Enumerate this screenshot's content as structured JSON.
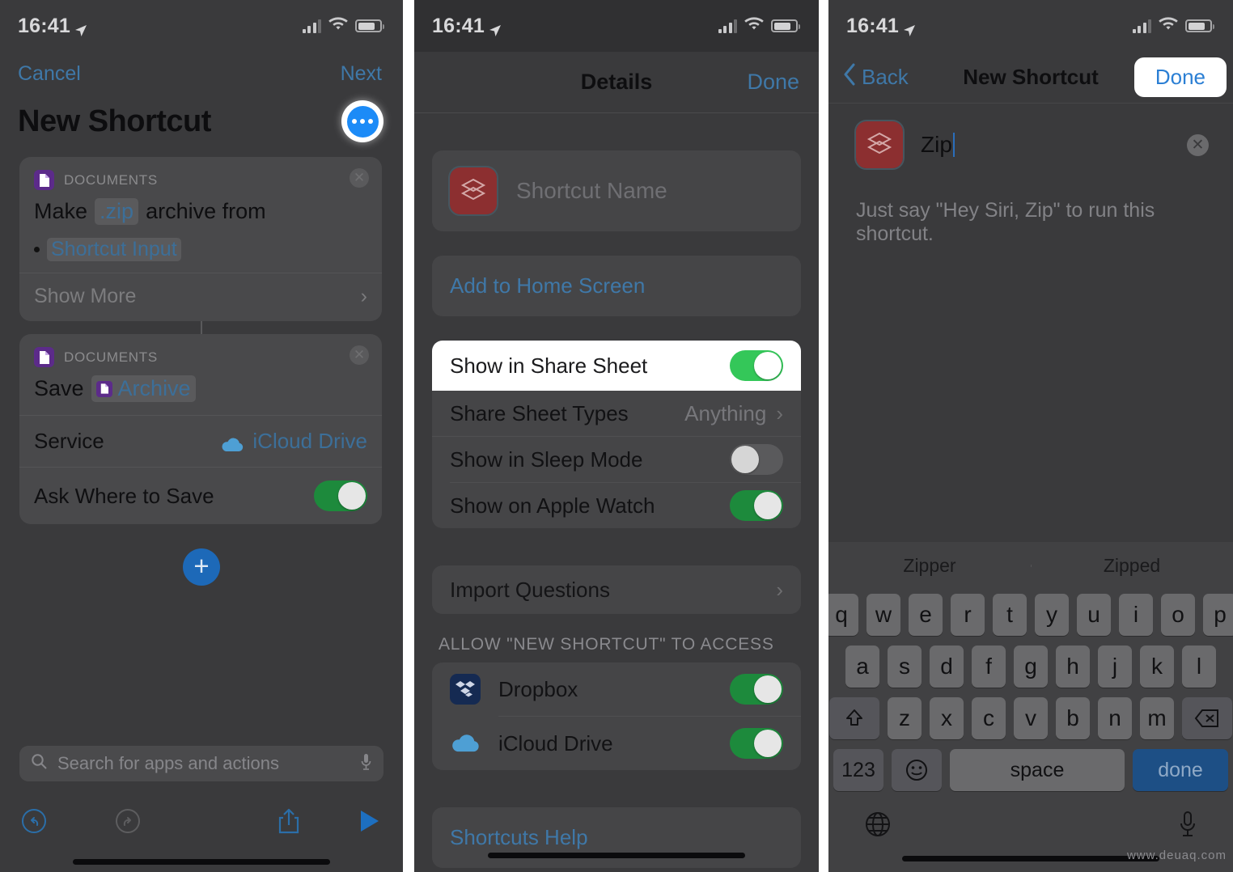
{
  "statusbar": {
    "time": "16:41"
  },
  "panel1": {
    "cancel_label": "Cancel",
    "next_label": "Next",
    "title": "New Shortcut",
    "more_icon": "ellipsis-icon",
    "cards": [
      {
        "category": "DOCUMENTS",
        "icon": "documents-icon",
        "action_prefix": "Make",
        "action_token": ".zip",
        "action_suffix": "archive from",
        "input_label": "Shortcut Input",
        "show_more_label": "Show More"
      },
      {
        "category": "DOCUMENTS",
        "icon": "documents-icon",
        "action_prefix": "Save",
        "action_token": "Archive",
        "rows": [
          {
            "label": "Service",
            "value": "iCloud Drive",
            "icon": "icloud-icon",
            "type": "value"
          },
          {
            "label": "Ask Where to Save",
            "value": "on",
            "type": "toggle"
          }
        ]
      }
    ],
    "add_button_icon": "plus-icon",
    "search_placeholder": "Search for apps and actions",
    "search_icon": "search-icon",
    "mic_icon": "microphone-icon",
    "toolbar": [
      {
        "icon": "undo-icon"
      },
      {
        "icon": "redo-icon"
      },
      {
        "icon": "share-icon"
      },
      {
        "icon": "play-icon"
      }
    ]
  },
  "panel2": {
    "sheet_title": "Details",
    "done_label": "Done",
    "shortcut_icon": "shortcuts-app-icon",
    "name_placeholder": "Shortcut Name",
    "add_to_home_label": "Add to Home Screen",
    "settings": [
      {
        "label": "Show in Share Sheet",
        "type": "toggle",
        "value": "on",
        "highlighted": true
      },
      {
        "label": "Share Sheet Types",
        "type": "value",
        "value": "Anything"
      },
      {
        "label": "Show in Sleep Mode",
        "type": "toggle",
        "value": "off"
      },
      {
        "label": "Show on Apple Watch",
        "type": "toggle",
        "value": "on"
      }
    ],
    "import_questions_label": "Import Questions",
    "access_section_header": "ALLOW \"NEW SHORTCUT\" TO ACCESS",
    "access_apps": [
      {
        "name": "Dropbox",
        "icon": "dropbox-icon",
        "value": "on"
      },
      {
        "name": "iCloud Drive",
        "icon": "icloud-icon",
        "value": "on"
      }
    ],
    "help_label": "Shortcuts Help"
  },
  "panel3": {
    "back_label": "Back",
    "title": "New Shortcut",
    "done_label": "Done",
    "shortcut_icon": "shortcuts-app-icon",
    "name_value": "Zip",
    "clear_icon": "clear-text-icon",
    "siri_hint": "Just say \"Hey Siri, Zip\" to run this shortcut.",
    "keyboard": {
      "suggestions": [
        "Zipper",
        "Zipped"
      ],
      "row1": [
        "q",
        "w",
        "e",
        "r",
        "t",
        "y",
        "u",
        "i",
        "o",
        "p"
      ],
      "row2": [
        "a",
        "s",
        "d",
        "f",
        "g",
        "h",
        "j",
        "k",
        "l"
      ],
      "row3": [
        "z",
        "x",
        "c",
        "v",
        "b",
        "n",
        "m"
      ],
      "shift_icon": "shift-icon",
      "backspace_icon": "backspace-icon",
      "num_label": "123",
      "emoji_icon": "emoji-icon",
      "space_label": "space",
      "done_label": "done",
      "globe_icon": "globe-icon",
      "dictation_icon": "microphone-icon"
    }
  },
  "watermark": "www.deuaq.com",
  "colors": {
    "accent_blue": "#3f78a8",
    "toggle_on": "#1d8a3c",
    "toggle_on_bright": "#34c759",
    "toggle_off": "#5a5a5c",
    "panel_bg": "#3a3a3c",
    "documents_purple": "#5c2b8a",
    "shortcut_red": "#8c2f30",
    "dropbox_navy": "#152a52"
  }
}
